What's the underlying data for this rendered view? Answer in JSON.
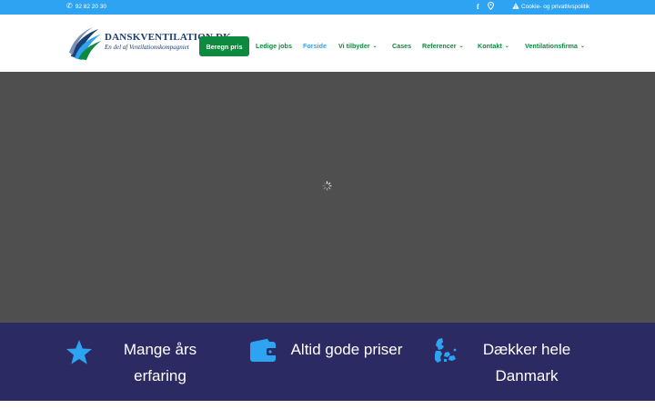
{
  "topbar": {
    "phone": "92 82 20 30",
    "cookie_link": "Cookie- og privatlivspolitik",
    "social_icons": [
      "facebook-icon",
      "location-pin-icon"
    ]
  },
  "logo": {
    "name": "DANSKVENTILATION",
    "name_suffix": ".DK",
    "tagline": "En del af Ventilationskompagniet"
  },
  "nav": {
    "cta": "Beregn pris",
    "items": [
      {
        "label": "Ledige jobs",
        "has_dropdown": false,
        "active": false
      },
      {
        "label": "Forside",
        "has_dropdown": false,
        "active": true
      },
      {
        "label": "Vi tilbyder",
        "has_dropdown": true,
        "active": false
      },
      {
        "label": "Cases",
        "has_dropdown": false,
        "active": false
      },
      {
        "label": "Referencer",
        "has_dropdown": true,
        "active": false
      },
      {
        "label": "Kontakt",
        "has_dropdown": true,
        "active": false
      },
      {
        "label": "Ventilationsfirma",
        "has_dropdown": true,
        "active": false
      }
    ]
  },
  "features": [
    {
      "icon": "star-icon",
      "line1": "Mange års",
      "line2": "erfaring"
    },
    {
      "icon": "wallet-icon",
      "line1": "Altid gode priser",
      "line2": ""
    },
    {
      "icon": "denmark-map-icon",
      "line1": "Dækker hele",
      "line2": "Danmark"
    }
  ],
  "colors": {
    "topbar": "#2ea3f2",
    "nav_green": "#0e8a3e",
    "nav_active": "#2ea3f2",
    "hero": "#4f4f4f",
    "features_bg": "#2b2a63",
    "icon_blue": "#2ea3f2"
  }
}
